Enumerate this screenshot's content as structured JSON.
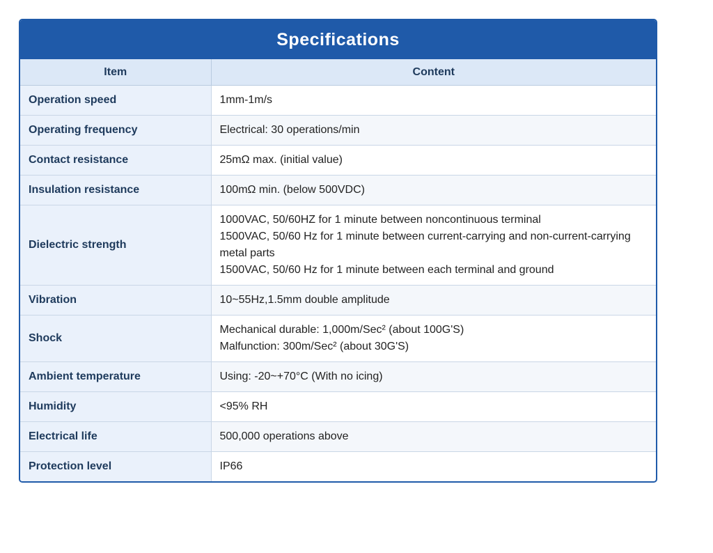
{
  "title": "Specifications",
  "headers": {
    "item": "Item",
    "content": "Content"
  },
  "rows": [
    {
      "item": "Operation speed",
      "content": [
        "1mm-1m/s"
      ]
    },
    {
      "item": "Operating frequency",
      "content": [
        "Electrical: 30 operations/min"
      ]
    },
    {
      "item": "Contact resistance",
      "content": [
        "25mΩ max. (initial value)"
      ]
    },
    {
      "item": "Insulation resistance",
      "content": [
        "100mΩ min. (below 500VDC)"
      ]
    },
    {
      "item": "Dielectric strength",
      "content": [
        "1000VAC, 50/60HZ for 1 minute between noncontinuous terminal",
        "1500VAC, 50/60 Hz for 1 minute between current-carrying and non-current-carrying metal parts",
        "1500VAC, 50/60 Hz for 1 minute between each terminal and ground"
      ]
    },
    {
      "item": "Vibration",
      "content": [
        "10~55Hz,1.5mm double amplitude"
      ]
    },
    {
      "item": "Shock",
      "content": [
        "Mechanical durable: 1,000m/Sec² (about 100G'S)",
        "Malfunction: 300m/Sec² (about 30G'S)"
      ]
    },
    {
      "item": "Ambient temperature",
      "content": [
        "Using: -20~+70°C (With no icing)"
      ]
    },
    {
      "item": "Humidity",
      "content": [
        "<95% RH"
      ]
    },
    {
      "item": "Electrical life",
      "content": [
        "500,000 operations above"
      ]
    },
    {
      "item": "Protection level",
      "content": [
        "IP66"
      ]
    }
  ]
}
